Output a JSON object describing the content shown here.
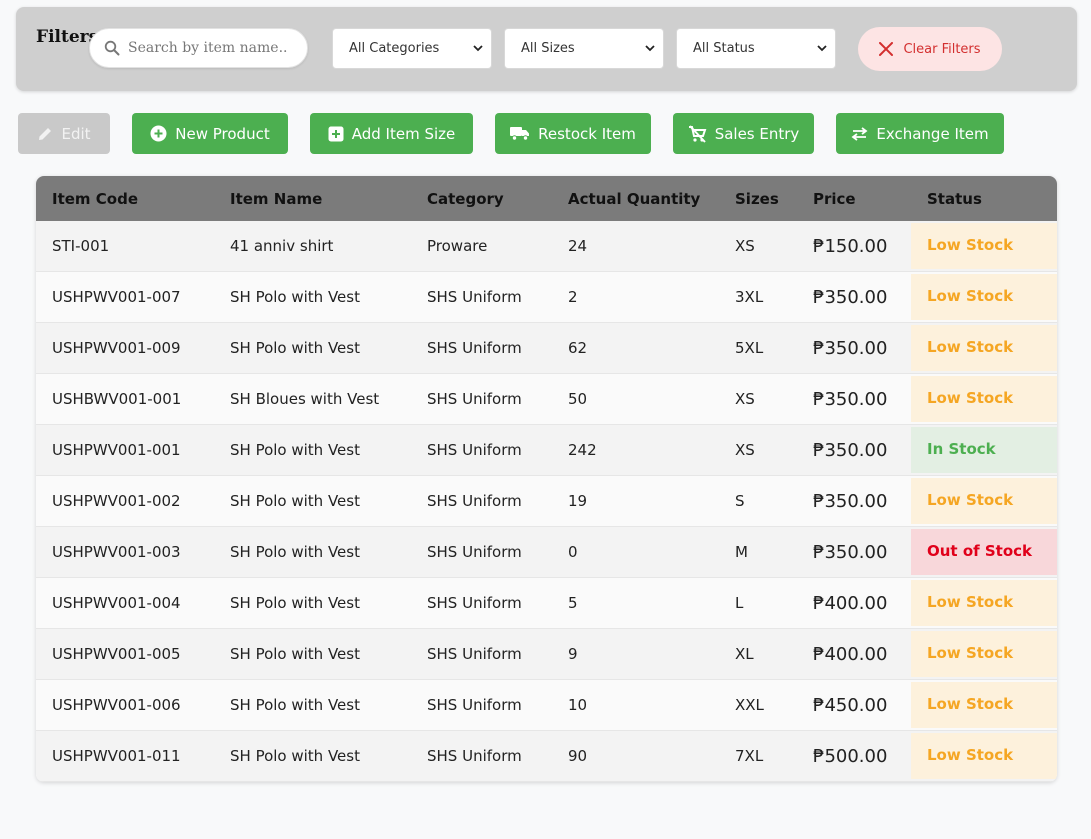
{
  "filters": {
    "title": "Filters",
    "search_placeholder": "Search by item name..",
    "category": "All Categories",
    "size": "All Sizes",
    "status": "All Status",
    "clear_label": "Clear Filters"
  },
  "actions": {
    "edit": "Edit",
    "new_product": "New Product",
    "add_item_size": "Add Item Size",
    "restock_item": "Restock Item",
    "sales_entry": "Sales Entry",
    "exchange_item": "Exchange Item"
  },
  "table": {
    "headers": [
      "Item Code",
      "Item Name",
      "Category",
      "Actual Quantity",
      "Sizes",
      "Price",
      "Status"
    ],
    "rows": [
      {
        "code": "STI-001",
        "name": "41 anniv shirt",
        "category": "Proware",
        "qty": "24",
        "size": "XS",
        "price": "₱150.00",
        "status": "Low Stock"
      },
      {
        "code": "USHPWV001-007",
        "name": "SH Polo with Vest",
        "category": "SHS Uniform",
        "qty": "2",
        "size": "3XL",
        "price": "₱350.00",
        "status": "Low Stock"
      },
      {
        "code": "USHPWV001-009",
        "name": "SH Polo with Vest",
        "category": "SHS Uniform",
        "qty": "62",
        "size": "5XL",
        "price": "₱350.00",
        "status": "Low Stock"
      },
      {
        "code": "USHBWV001-001",
        "name": "SH Bloues with Vest",
        "category": "SHS Uniform",
        "qty": "50",
        "size": "XS",
        "price": "₱350.00",
        "status": "Low Stock"
      },
      {
        "code": "USHPWV001-001",
        "name": "SH Polo with Vest",
        "category": "SHS Uniform",
        "qty": "242",
        "size": "XS",
        "price": "₱350.00",
        "status": "In Stock"
      },
      {
        "code": "USHPWV001-002",
        "name": "SH Polo with Vest",
        "category": "SHS Uniform",
        "qty": "19",
        "size": "S",
        "price": "₱350.00",
        "status": "Low Stock"
      },
      {
        "code": "USHPWV001-003",
        "name": "SH Polo with Vest",
        "category": "SHS Uniform",
        "qty": "0",
        "size": "M",
        "price": "₱350.00",
        "status": "Out of Stock"
      },
      {
        "code": "USHPWV001-004",
        "name": "SH Polo with Vest",
        "category": "SHS Uniform",
        "qty": "5",
        "size": "L",
        "price": "₱400.00",
        "status": "Low Stock"
      },
      {
        "code": "USHPWV001-005",
        "name": "SH Polo with Vest",
        "category": "SHS Uniform",
        "qty": "9",
        "size": "XL",
        "price": "₱400.00",
        "status": "Low Stock"
      },
      {
        "code": "USHPWV001-006",
        "name": "SH Polo with Vest",
        "category": "SHS Uniform",
        "qty": "10",
        "size": "XXL",
        "price": "₱450.00",
        "status": "Low Stock"
      },
      {
        "code": "USHPWV001-011",
        "name": "SH Polo with Vest",
        "category": "SHS Uniform",
        "qty": "90",
        "size": "7XL",
        "price": "₱500.00",
        "status": "Low Stock"
      }
    ]
  },
  "colors": {
    "primary_green": "#4caf50",
    "low_stock": "#f5a623",
    "in_stock": "#4caf50",
    "out_of_stock": "#e0001a"
  }
}
